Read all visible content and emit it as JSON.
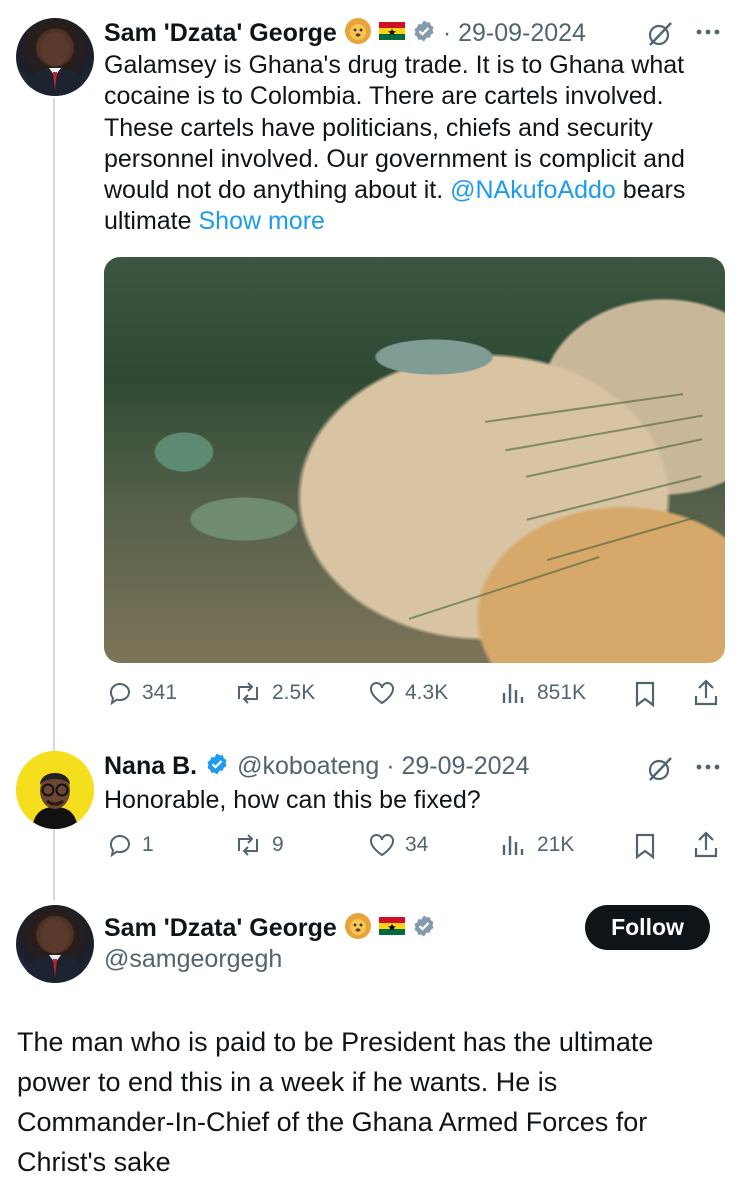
{
  "colors": {
    "link": "#1d9bf0",
    "muted": "#536471",
    "text": "#0f1419",
    "verified": "#829aab"
  },
  "tweet1": {
    "name": "Sam 'Dzata' George",
    "emojis": [
      "lion-face",
      "ghana-flag"
    ],
    "date": "· 29-09-2024",
    "text_before": "Galamsey is Ghana's drug trade. It is to Ghana what cocaine is to Colombia. There are cartels involved. These cartels have politicians, chiefs and security personnel involved. Our government is complicit and would not do anything about it. ",
    "mention": "@NAkufoAddo",
    "text_after": " bears\nultimate ",
    "show_more": "Show more",
    "media_description_icon": "image-aerial-galamsey",
    "stats": {
      "replies": "341",
      "reposts": "2.5K",
      "likes": "4.3K",
      "views": "851K"
    }
  },
  "tweet2": {
    "name": "Nana B.",
    "handle_date": "@koboateng · 29-09-2024",
    "text": "Honorable, how can this be fixed?",
    "stats": {
      "replies": "1",
      "reposts": "9",
      "likes": "34",
      "views": "21K"
    }
  },
  "main": {
    "name": "Sam 'Dzata' George",
    "handle": "@samgeorgegh",
    "follow_label": "Follow",
    "text": "The man who is paid to be President has the ultimate\npower to end this in a week if he wants. He is\nCommander-In-Chief of the Ghana Armed Forces for\nChrist's sake"
  }
}
